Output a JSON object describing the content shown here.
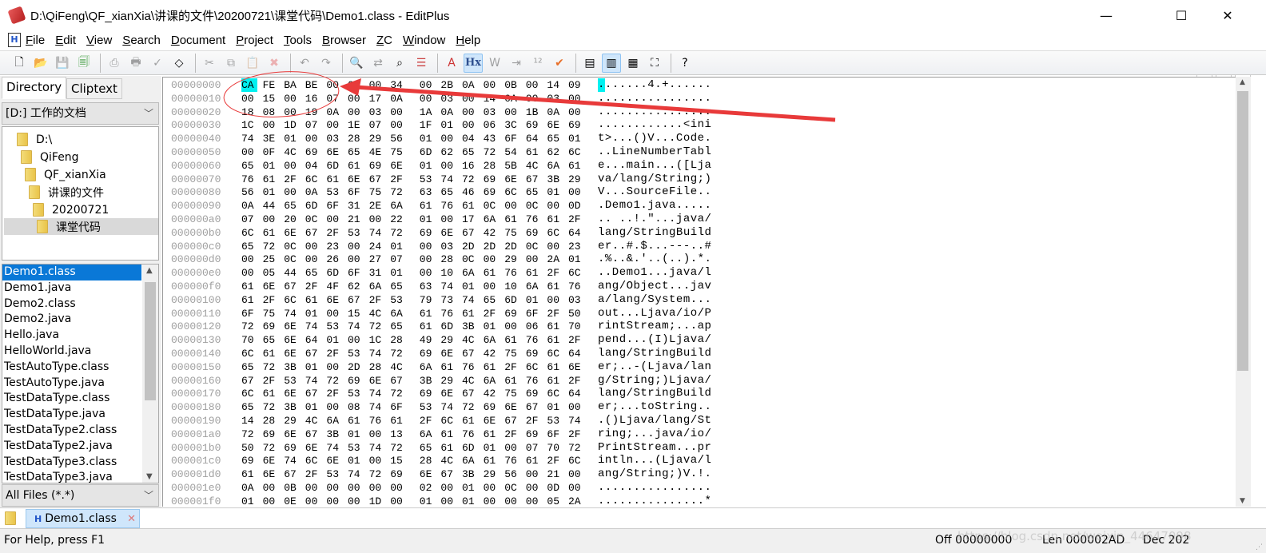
{
  "window": {
    "title": "D:\\QiFeng\\QF_xianXia\\讲课的文件\\20200721\\课堂代码\\Demo1.class - EditPlus",
    "minimize": "—",
    "maximize": "☐",
    "close": "✕"
  },
  "menu": [
    "File",
    "Edit",
    "View",
    "Search",
    "Document",
    "Project",
    "Tools",
    "Browser",
    "ZC",
    "Window",
    "Help"
  ],
  "mdi_controls": [
    "_",
    "🗗",
    "✕"
  ],
  "toolbar": {
    "icons": [
      "new-file",
      "open",
      "save",
      "save-all",
      "|",
      "print-preview",
      "print",
      "spell-check",
      "browser-preview",
      "|",
      "cut",
      "copy",
      "paste",
      "delete",
      "|",
      "undo",
      "redo",
      "|",
      "find",
      "replace",
      "find-in-files",
      "goto-line",
      "|",
      "font",
      "hex-view",
      "word-wrap",
      "indent",
      "line-numbers",
      "check",
      "|",
      "directory-window",
      "output-window",
      "cliptext-window",
      "full-screen",
      "|",
      "context-help"
    ],
    "active": [
      "hex-view",
      "output-window"
    ]
  },
  "sidebar": {
    "tabs": [
      "Directory",
      "Cliptext"
    ],
    "drive": "[D:] 工作的文档",
    "tree": [
      "D:\\",
      "QiFeng",
      "QF_xianXia",
      "讲课的文件",
      "20200721",
      "课堂代码"
    ],
    "selected_folder": "课堂代码",
    "files": [
      "Demo1.class",
      "Demo1.java",
      "Demo2.class",
      "Demo2.java",
      "Hello.java",
      "HelloWorld.java",
      "TestAutoType.class",
      "TestAutoType.java",
      "TestDataType.class",
      "TestDataType.java",
      "TestDataType2.class",
      "TestDataType2.java",
      "TestDataType3.class",
      "TestDataType3.java"
    ],
    "selected_file": "Demo1.class",
    "filter": "All Files (*.*)"
  },
  "hex": {
    "rows": [
      {
        "off": "00000000",
        "bytes": "CA FE BA BE 00 00 00 34 00 2B 0A 00 0B 00 14 09",
        "ascii": ".......4.+......"
      },
      {
        "off": "00000010",
        "bytes": "00 15 00 16 07 00 17 0A 00 03 00 14 0A 00 03 00",
        "ascii": "................"
      },
      {
        "off": "00000020",
        "bytes": "18 08 00 19 0A 00 03 00 1A 0A 00 03 00 1B 0A 00",
        "ascii": "................"
      },
      {
        "off": "00000030",
        "bytes": "1C 00 1D 07 00 1E 07 00 1F 01 00 06 3C 69 6E 69",
        "ascii": "............<ini"
      },
      {
        "off": "00000040",
        "bytes": "74 3E 01 00 03 28 29 56 01 00 04 43 6F 64 65 01",
        "ascii": "t>...()V...Code."
      },
      {
        "off": "00000050",
        "bytes": "00 0F 4C 69 6E 65 4E 75 6D 62 65 72 54 61 62 6C",
        "ascii": "..LineNumberTabl"
      },
      {
        "off": "00000060",
        "bytes": "65 01 00 04 6D 61 69 6E 01 00 16 28 5B 4C 6A 61",
        "ascii": "e...main...([Lja"
      },
      {
        "off": "00000070",
        "bytes": "76 61 2F 6C 61 6E 67 2F 53 74 72 69 6E 67 3B 29",
        "ascii": "va/lang/String;)"
      },
      {
        "off": "00000080",
        "bytes": "56 01 00 0A 53 6F 75 72 63 65 46 69 6C 65 01 00",
        "ascii": "V...SourceFile.."
      },
      {
        "off": "00000090",
        "bytes": "0A 44 65 6D 6F 31 2E 6A 61 76 61 0C 00 0C 00 0D",
        "ascii": ".Demo1.java....."
      },
      {
        "off": "000000a0",
        "bytes": "07 00 20 0C 00 21 00 22 01 00 17 6A 61 76 61 2F",
        "ascii": ".. ..!.\"...java/"
      },
      {
        "off": "000000b0",
        "bytes": "6C 61 6E 67 2F 53 74 72 69 6E 67 42 75 69 6C 64",
        "ascii": "lang/StringBuild"
      },
      {
        "off": "000000c0",
        "bytes": "65 72 0C 00 23 00 24 01 00 03 2D 2D 2D 0C 00 23",
        "ascii": "er..#.$...---..#"
      },
      {
        "off": "000000d0",
        "bytes": "00 25 0C 00 26 00 27 07 00 28 0C 00 29 00 2A 01",
        "ascii": ".%..&.'..(..).*."
      },
      {
        "off": "000000e0",
        "bytes": "00 05 44 65 6D 6F 31 01 00 10 6A 61 76 61 2F 6C",
        "ascii": "..Demo1...java/l"
      },
      {
        "off": "000000f0",
        "bytes": "61 6E 67 2F 4F 62 6A 65 63 74 01 00 10 6A 61 76",
        "ascii": "ang/Object...jav"
      },
      {
        "off": "00000100",
        "bytes": "61 2F 6C 61 6E 67 2F 53 79 73 74 65 6D 01 00 03",
        "ascii": "a/lang/System..."
      },
      {
        "off": "00000110",
        "bytes": "6F 75 74 01 00 15 4C 6A 61 76 61 2F 69 6F 2F 50",
        "ascii": "out...Ljava/io/P"
      },
      {
        "off": "00000120",
        "bytes": "72 69 6E 74 53 74 72 65 61 6D 3B 01 00 06 61 70",
        "ascii": "rintStream;...ap"
      },
      {
        "off": "00000130",
        "bytes": "70 65 6E 64 01 00 1C 28 49 29 4C 6A 61 76 61 2F",
        "ascii": "pend...(I)Ljava/"
      },
      {
        "off": "00000140",
        "bytes": "6C 61 6E 67 2F 53 74 72 69 6E 67 42 75 69 6C 64",
        "ascii": "lang/StringBuild"
      },
      {
        "off": "00000150",
        "bytes": "65 72 3B 01 00 2D 28 4C 6A 61 76 61 2F 6C 61 6E",
        "ascii": "er;..-(Ljava/lan"
      },
      {
        "off": "00000160",
        "bytes": "67 2F 53 74 72 69 6E 67 3B 29 4C 6A 61 76 61 2F",
        "ascii": "g/String;)Ljava/"
      },
      {
        "off": "00000170",
        "bytes": "6C 61 6E 67 2F 53 74 72 69 6E 67 42 75 69 6C 64",
        "ascii": "lang/StringBuild"
      },
      {
        "off": "00000180",
        "bytes": "65 72 3B 01 00 08 74 6F 53 74 72 69 6E 67 01 00",
        "ascii": "er;...toString.."
      },
      {
        "off": "00000190",
        "bytes": "14 28 29 4C 6A 61 76 61 2F 6C 61 6E 67 2F 53 74",
        "ascii": ".()Ljava/lang/St"
      },
      {
        "off": "000001a0",
        "bytes": "72 69 6E 67 3B 01 00 13 6A 61 76 61 2F 69 6F 2F",
        "ascii": "ring;...java/io/"
      },
      {
        "off": "000001b0",
        "bytes": "50 72 69 6E 74 53 74 72 65 61 6D 01 00 07 70 72",
        "ascii": "PrintStream...pr"
      },
      {
        "off": "000001c0",
        "bytes": "69 6E 74 6C 6E 01 00 15 28 4C 6A 61 76 61 2F 6C",
        "ascii": "intln...(Ljava/l"
      },
      {
        "off": "000001d0",
        "bytes": "61 6E 67 2F 53 74 72 69 6E 67 3B 29 56 00 21 00",
        "ascii": "ang/String;)V.!."
      },
      {
        "off": "000001e0",
        "bytes": "0A 00 0B 00 00 00 00 00 02 00 01 00 0C 00 0D 00",
        "ascii": "................"
      },
      {
        "off": "000001f0",
        "bytes": "01 00 0E 00 00 00 1D 00 01 00 01 00 00 00 05 2A",
        "ascii": "...............*"
      }
    ],
    "cursor_color": "#00f0f0"
  },
  "tabs": {
    "document": "Demo1.class",
    "close": "✕"
  },
  "status": {
    "help": "For Help, press F1",
    "offset": "Off 00000000",
    "length": "Len 000002AD",
    "dec": "Dec 202"
  },
  "watermark": "https://blog.csdn.net/weixin_44647098",
  "annotation_color": "#e83a3a"
}
